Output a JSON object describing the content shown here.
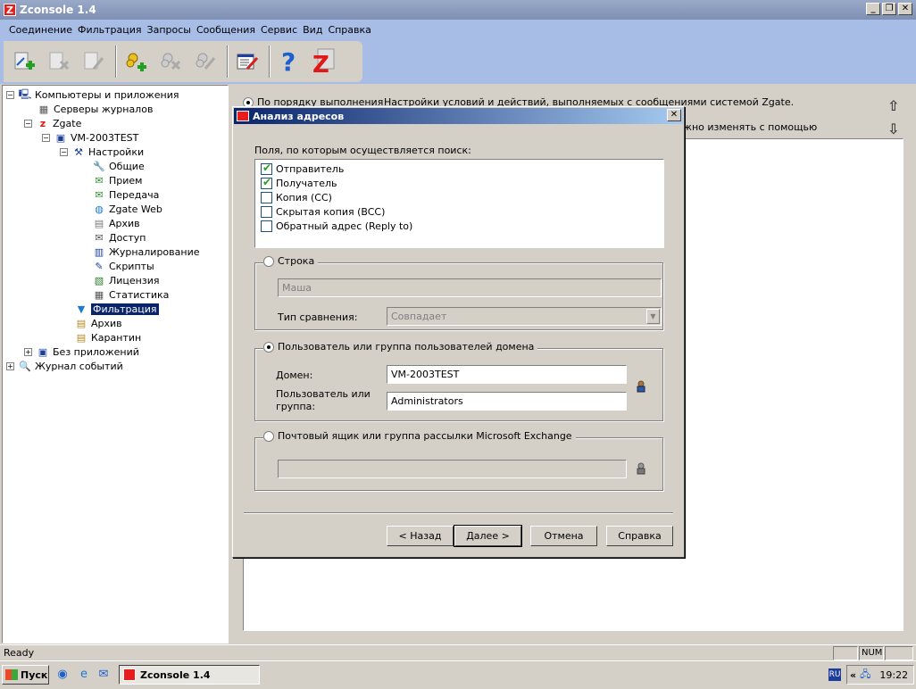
{
  "window": {
    "title": "Zconsole 1.4",
    "btn_min": "_",
    "btn_restore": "❐",
    "btn_close": "✕"
  },
  "menu": [
    "Соединение",
    "Фильтрация",
    "Запросы",
    "Сообщения",
    "Сервис",
    "Вид",
    "Справка"
  ],
  "toolbar": {
    "icons": [
      "connect-add-icon",
      "disconnect-icon",
      "edit-connection-icon",
      "add-server-icon",
      "remove-server-icon",
      "server-properties-icon",
      "log-edit-icon",
      "help-icon",
      "zgate-about-icon"
    ]
  },
  "tree": {
    "root": "Компьютеры и приложения",
    "log_servers": "Серверы журналов",
    "zgate": "Zgate",
    "server": "VM-2003TEST",
    "settings": "Настройки",
    "general": "Общие",
    "receive": "Прием",
    "transfer": "Передача",
    "zgate_web": "Zgate Web",
    "archive_settings": "Архив",
    "access": "Доступ",
    "logging": "Журналирование",
    "scripts": "Скрипты",
    "license": "Лицензия",
    "statistics": "Статистика",
    "filtering": "Фильтрация",
    "archive": "Архив",
    "quarantine": "Карантин",
    "no_apps": "Без приложений",
    "event_log": "Журнал событий"
  },
  "right_pane": {
    "radio_label": "По порядку выполнения",
    "description_line1": "Настройки условий и действий, выполняемых с сообщениями системой Zgate. Выберите тип",
    "description_line2": "можно изменять с помощью их"
  },
  "dialog": {
    "title": "Анализ адресов",
    "fields_label": "Поля, по которым осуществляется поиск:",
    "fields": [
      {
        "label": "Отправитель",
        "checked": true
      },
      {
        "label": "Получатель",
        "checked": true
      },
      {
        "label": "Копия (CC)",
        "checked": false
      },
      {
        "label": "Скрытая копия (BCC)",
        "checked": false
      },
      {
        "label": "Обратный адрес (Reply to)",
        "checked": false
      }
    ],
    "string_group": {
      "caption": "Строка",
      "value": "Маша",
      "compare_label": "Тип сравнения:",
      "compare_value": "Совпадает"
    },
    "domain_group": {
      "caption": "Пользователь или группа пользователей домена",
      "domain_label": "Домен:",
      "domain_value": "VM-2003TEST",
      "user_label_1": "Пользователь или",
      "user_label_2": "группа:",
      "user_value": "Administrators"
    },
    "exchange_group": {
      "caption": "Почтовый ящик или группа рассылки Microsoft Exchange",
      "value": ""
    },
    "buttons": {
      "back": "< Назад",
      "next": "Далее >",
      "cancel": "Отмена",
      "help": "Справка"
    }
  },
  "status": {
    "text": "Ready",
    "num": "NUM"
  },
  "taskbar": {
    "start": "Пуск",
    "task": "Zconsole 1.4",
    "lang": "RU",
    "clock": "19:22"
  }
}
